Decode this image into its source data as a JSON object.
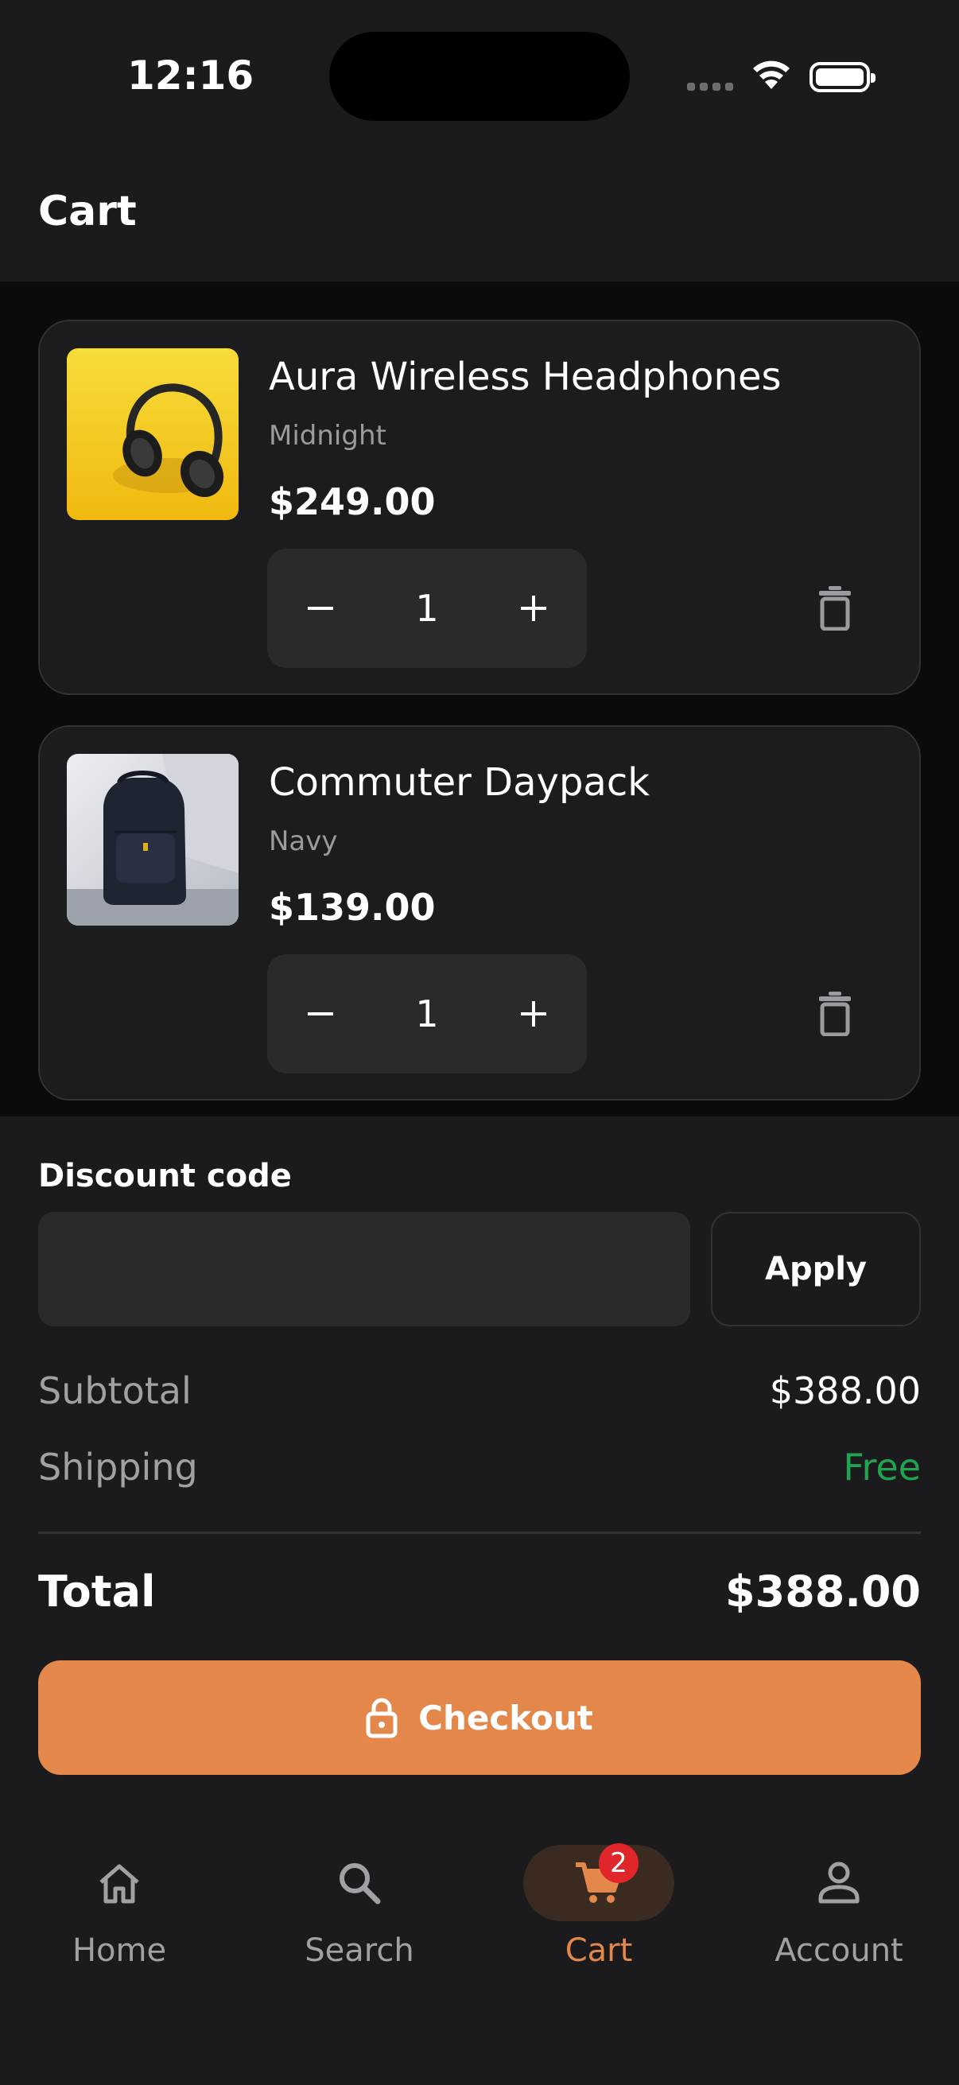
{
  "status_bar": {
    "time": "12:16"
  },
  "header": {
    "title": "Cart"
  },
  "cart_items": [
    {
      "name": "Aura Wireless Headphones",
      "variant": "Midnight",
      "price": "$249.00",
      "quantity": "1",
      "thumbnail": "headphones-on-yellow"
    },
    {
      "name": "Commuter Daypack",
      "variant": "Navy",
      "price": "$139.00",
      "quantity": "1",
      "thumbnail": "navy-backpack"
    }
  ],
  "discount": {
    "label": "Discount code",
    "value": "",
    "placeholder": "",
    "apply_label": "Apply"
  },
  "summary": {
    "subtotal_label": "Subtotal",
    "subtotal_value": "$388.00",
    "shipping_label": "Shipping",
    "shipping_value": "Free",
    "total_label": "Total",
    "total_value": "$388.00"
  },
  "checkout": {
    "label": "Checkout",
    "icon": "lock-icon"
  },
  "bottom_nav": {
    "items": [
      {
        "label": "Home",
        "icon": "home-icon"
      },
      {
        "label": "Search",
        "icon": "search-icon"
      },
      {
        "label": "Cart",
        "icon": "cart-icon",
        "active": true,
        "badge": "2"
      },
      {
        "label": "Account",
        "icon": "person-icon"
      }
    ]
  },
  "colors": {
    "accent": "#e4874a",
    "free": "#22a352",
    "badge": "#e0262a",
    "background": "#1b1b1d"
  }
}
